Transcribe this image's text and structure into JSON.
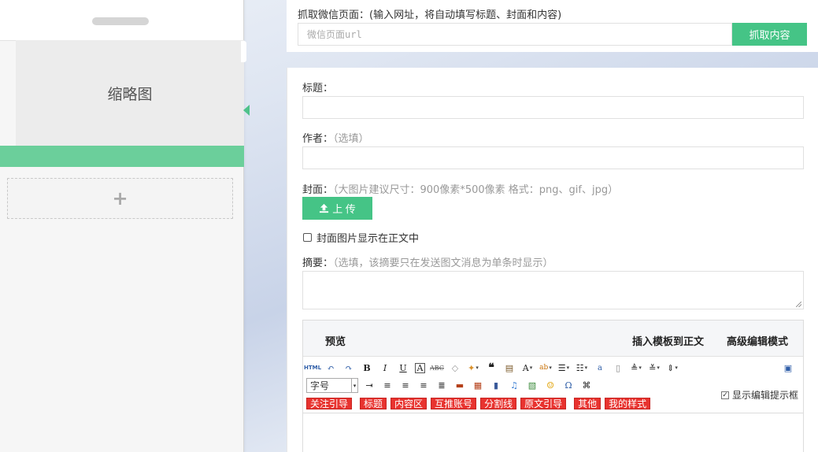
{
  "preview": {
    "thumbnail_label": "缩略图",
    "add_symbol": "+"
  },
  "fetch": {
    "label": "抓取微信页面：(输入网址，将自动填写标题、封面和内容)",
    "placeholder": "微信页面url",
    "button": "抓取内容"
  },
  "form": {
    "title_label": "标题：",
    "author_label": "作者：",
    "author_hint": "（选填）",
    "cover_label": "封面：",
    "cover_hint": "（大图片建议尺寸：900像素*500像素 格式：png、gif、jpg）",
    "upload_button": "上 传",
    "cover_in_body": "封面图片显示在正文中",
    "summary_label": "摘要：",
    "summary_hint": "（选填，该摘要只在发送图文消息为单条时显示）"
  },
  "editor": {
    "preview_tab": "预览",
    "insert_template": "插入模板到正文",
    "advanced_mode": "高级编辑模式",
    "font_size_select": "字号",
    "show_tips": "显示编辑提示框",
    "show_tips_checked": "✓",
    "tags": [
      "关注引导",
      "标题",
      "内容区",
      "互推账号",
      "分割线",
      "原文引导",
      "其他",
      "我的样式"
    ]
  },
  "colors": {
    "accent_green": "#45c486",
    "preview_bar_green": "#6bcf9b",
    "tag_red": "#e8332f"
  }
}
